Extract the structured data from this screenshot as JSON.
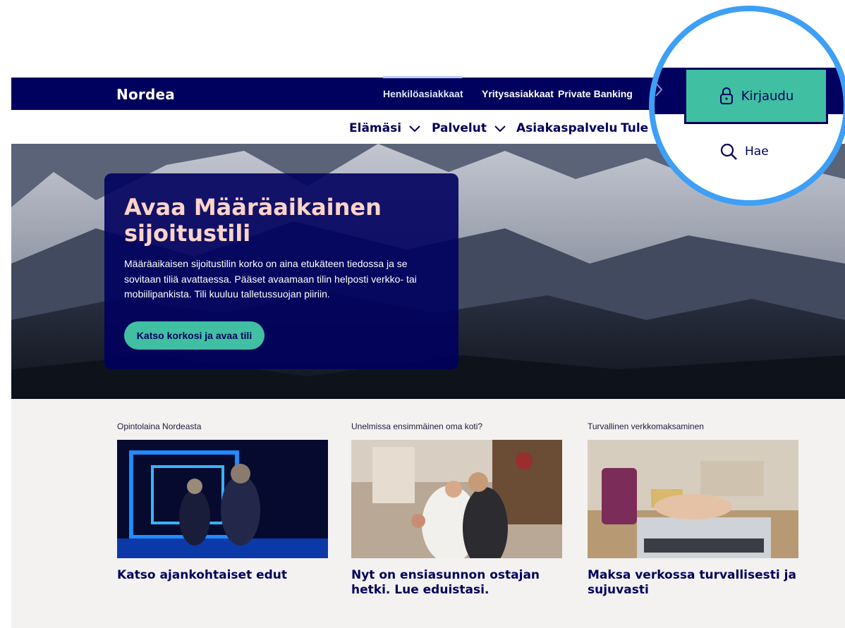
{
  "header": {
    "logo": "Nordea",
    "segments": [
      {
        "label": "Henkilöasiakkaat",
        "active": true
      },
      {
        "label": "Yritysasiakkaat",
        "active": false
      },
      {
        "label": "Private Banking",
        "active": false
      }
    ],
    "login_label": "Kirjaudu",
    "search_label": "Hae"
  },
  "subnav": {
    "items": [
      {
        "label": "Elämäsi",
        "has_dropdown": true
      },
      {
        "label": "Palvelut",
        "has_dropdown": true
      },
      {
        "label": "Asiakaspalvelu",
        "has_dropdown": false
      },
      {
        "label": "Tule a",
        "has_dropdown": false
      }
    ]
  },
  "hero": {
    "title": "Avaa Määräaikainen sijoitustili",
    "text": "Määräaikaisen sijoitustilin korko on aina etukäteen tiedossa ja se sovitaan tiliä avattaessa. Pääset avaamaan tilin helposti verkko- tai mobiilipankista. Tili kuuluu talletussuojan piiriin.",
    "button_label": "Katso korkosi ja avaa tili"
  },
  "cards": [
    {
      "kicker": "Opintolaina Nordeasta",
      "title": "Katso ajankohtaiset edut"
    },
    {
      "kicker": "Unelmissa ensimmäinen oma koti?",
      "title": "Nyt on ensiasunnon ostajan hetki. Lue eduistasi."
    },
    {
      "kicker": "Turvallinen verkkomaksaminen",
      "title": "Maksa verkossa turvallisesti ja sujuvasti"
    }
  ],
  "colors": {
    "navy": "#00005e",
    "accent_green": "#40bfa3",
    "hero_title": "#ffd3c8",
    "highlight_ring": "#3d9ff5",
    "lower_bg": "#f3f2f1"
  }
}
